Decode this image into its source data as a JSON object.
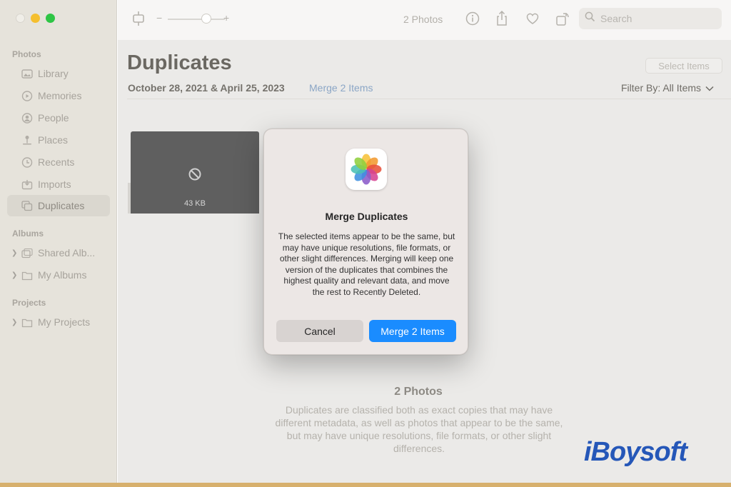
{
  "sidebar": {
    "section_photos": "Photos",
    "section_albums": "Albums",
    "section_projects": "Projects",
    "items": [
      {
        "label": "Library"
      },
      {
        "label": "Memories"
      },
      {
        "label": "People"
      },
      {
        "label": "Places"
      },
      {
        "label": "Recents"
      },
      {
        "label": "Imports"
      },
      {
        "label": "Duplicates",
        "selected": true
      }
    ],
    "albums": [
      {
        "label": "Shared Alb..."
      },
      {
        "label": "My Albums"
      }
    ],
    "projects": [
      {
        "label": "My Projects"
      }
    ]
  },
  "toolbar": {
    "zoom_minus": "−",
    "zoom_plus": "+",
    "photo_count": "2 Photos",
    "search_placeholder": "Search"
  },
  "main": {
    "title": "Duplicates",
    "select_items": "Select Items",
    "dates": "October 28, 2021 & April 25, 2023",
    "merge_link": "Merge 2 Items",
    "filter": "Filter By: All Items",
    "thumb_size": "43 KB",
    "empty_title": "2 Photos",
    "empty_desc": "Duplicates are classified both as exact copies that may have different metadata, as well as photos that appear to be the same, but may have unique resolutions, file formats, or other slight differences."
  },
  "dialog": {
    "title": "Merge Duplicates",
    "message": "The selected items appear to be the same, but may have unique resolutions, file formats, or other slight differences. Merging will keep one version of the duplicates that combines the highest quality and relevant data, and move the rest to Recently Deleted.",
    "cancel_label": "Cancel",
    "merge_label": "Merge 2 Items"
  },
  "watermark": "iBoysoft",
  "colors": {
    "accent": "#1a8cff",
    "link": "#8ba6c6",
    "brand": "#2557b8"
  }
}
